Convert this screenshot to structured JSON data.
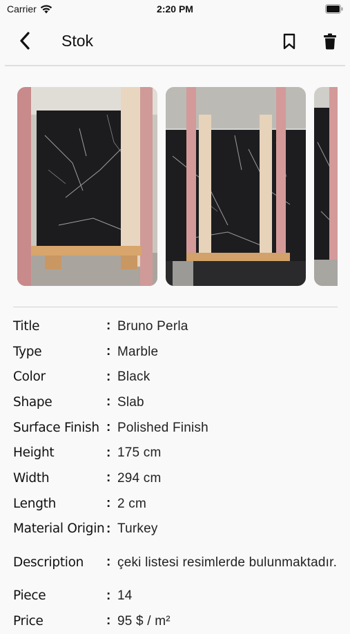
{
  "status_bar": {
    "carrier": "Carrier",
    "time": "2:20 PM"
  },
  "nav": {
    "title": "Stok",
    "back_icon": "chevron-left-icon",
    "bookmark_icon": "bookmark-icon",
    "delete_icon": "trash-icon"
  },
  "gallery": {
    "photos": [
      "stone-slab-photo-1",
      "stone-slab-photo-2",
      "stone-slab-photo-3"
    ]
  },
  "details": [
    {
      "label": "Title",
      "value": "Bruno Perla"
    },
    {
      "label": "Type",
      "value": "Marble"
    },
    {
      "label": "Color",
      "value": "Black"
    },
    {
      "label": "Shape",
      "value": "Slab"
    },
    {
      "label": "Surface Finish",
      "value": "Polished Finish"
    },
    {
      "label": "Height",
      "value": "175 cm"
    },
    {
      "label": "Width",
      "value": "294 cm"
    },
    {
      "label": "Length",
      "value": "2 cm"
    },
    {
      "label": "Material Origin",
      "value": "Turkey"
    },
    {
      "label": "Description",
      "value": "çeki listesi resimlerde bulunmaktadır."
    },
    {
      "label": "Piece",
      "value": "14"
    },
    {
      "label": "Price",
      "value": "95 $ / m²"
    }
  ],
  "colors": {
    "background": "#f9f9f9",
    "text": "#111111",
    "divider": "#dedede"
  }
}
